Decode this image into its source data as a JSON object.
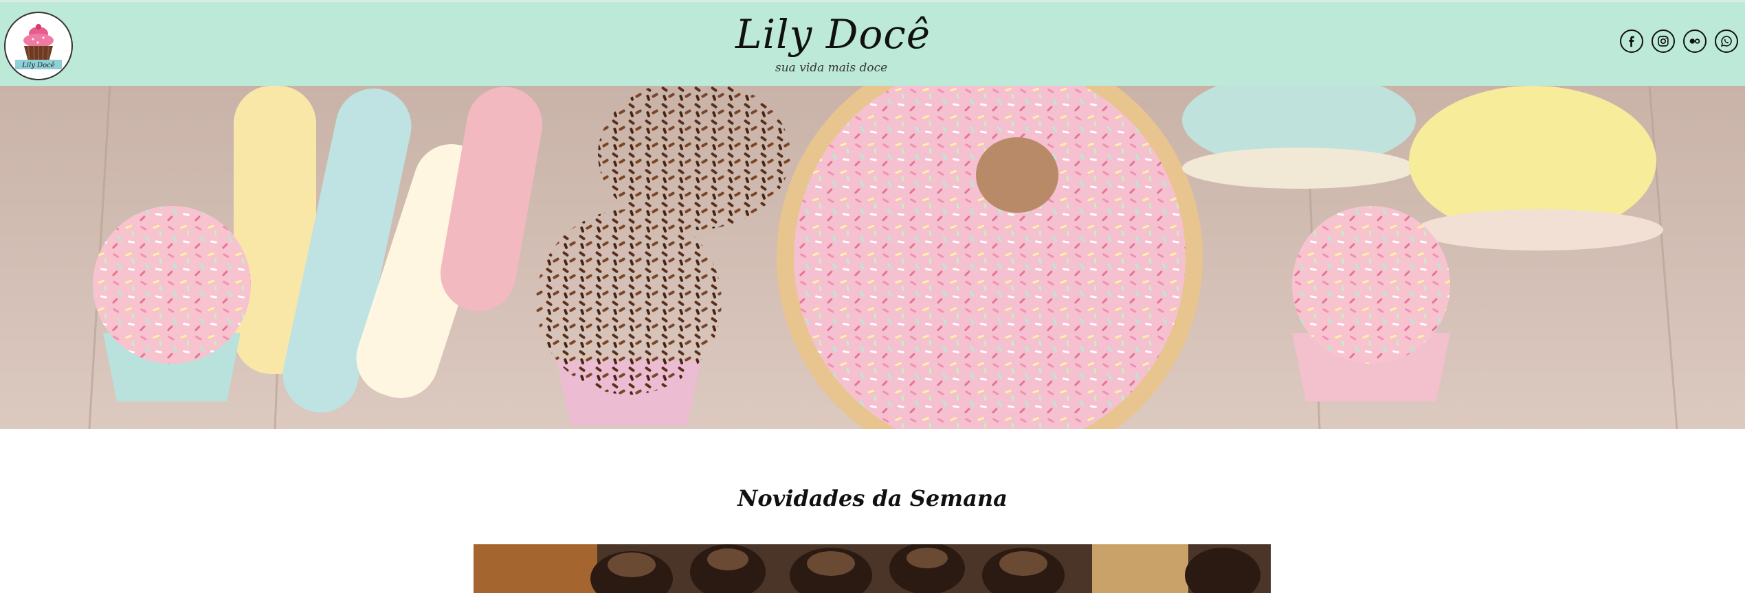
{
  "header": {
    "logo_text": "Lily Docê",
    "title": "Lily Docê",
    "subtitle": "sua vida mais doce",
    "social": [
      {
        "name": "facebook",
        "icon": "facebook-icon"
      },
      {
        "name": "instagram",
        "icon": "instagram-icon"
      },
      {
        "name": "flickr",
        "icon": "flickr-icon"
      },
      {
        "name": "whatsapp",
        "icon": "whatsapp-icon"
      }
    ],
    "background": "#bde9d8"
  },
  "hero": {
    "description_icon": "sweets-photo"
  },
  "main": {
    "section_title": "Novidades da Semana"
  }
}
